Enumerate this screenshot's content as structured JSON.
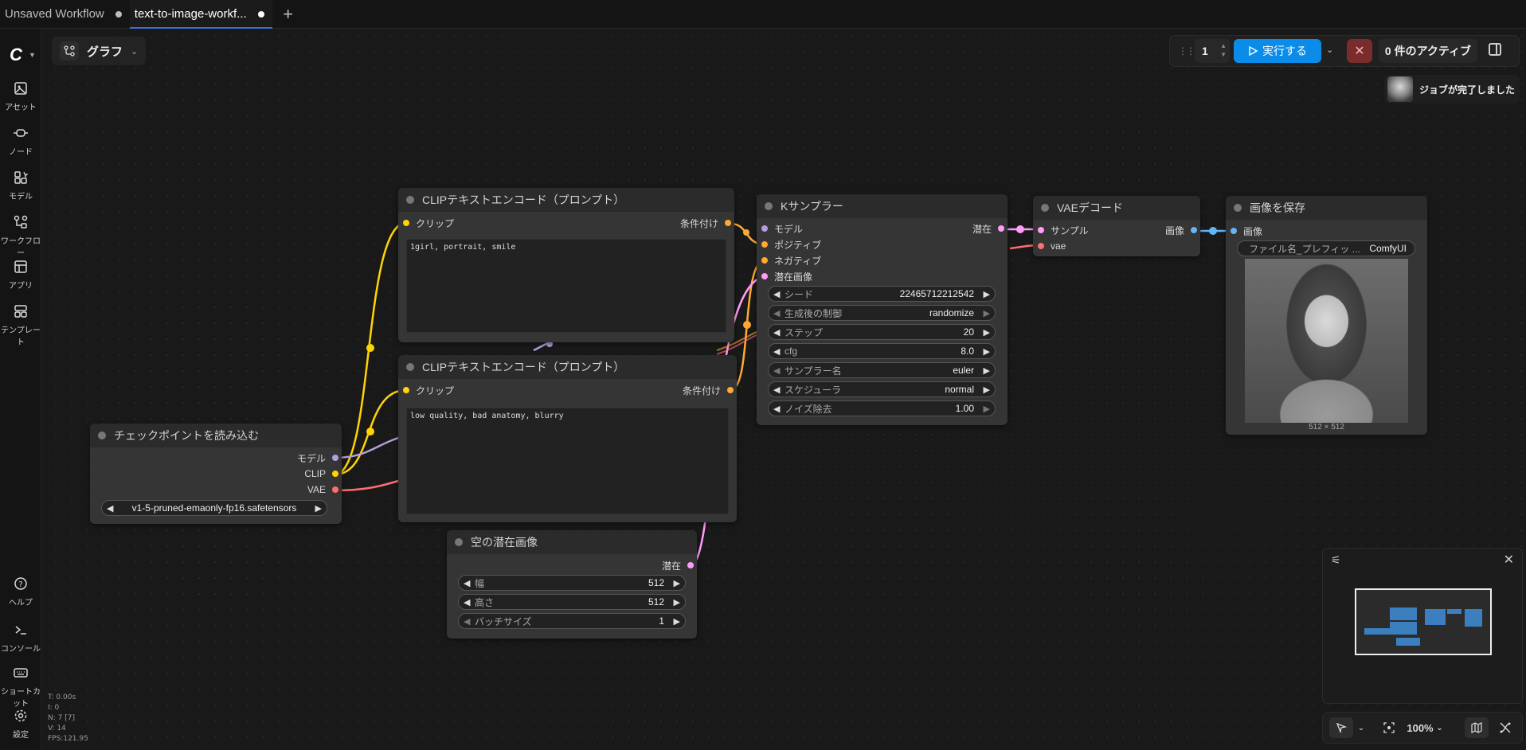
{
  "tabs": [
    {
      "label": "Unsaved Workflow"
    },
    {
      "label": "text-to-image-workf..."
    }
  ],
  "sidebar": {
    "top_items": [
      {
        "label": "アセット",
        "icon": "image-icon"
      },
      {
        "label": "ノード",
        "icon": "node-icon"
      },
      {
        "label": "モデル",
        "icon": "model-icon"
      },
      {
        "label": "ワークフロー",
        "icon": "workflow-icon"
      },
      {
        "label": "アプリ",
        "icon": "app-icon"
      },
      {
        "label": "テンプレート",
        "icon": "template-icon"
      }
    ],
    "bottom_items": [
      {
        "label": "ヘルプ",
        "icon": "help-icon"
      },
      {
        "label": "コンソール",
        "icon": "console-icon"
      },
      {
        "label": "ショートカット",
        "icon": "keyboard-icon"
      },
      {
        "label": "設定",
        "icon": "gear-icon"
      }
    ]
  },
  "graph_menu": {
    "label": "グラフ"
  },
  "run_toolbar": {
    "queue_count": "1",
    "run_label": "実行する",
    "active_jobs": "0 件のアクティブ"
  },
  "job_toast": {
    "label": "ジョブが完了しました"
  },
  "nodes": {
    "clip_pos": {
      "title": "CLIPテキストエンコード（プロンプト）",
      "input": "クリップ",
      "output": "条件付け",
      "text": "1girl, portrait, smile"
    },
    "clip_neg": {
      "title": "CLIPテキストエンコード（プロンプト）",
      "input": "クリップ",
      "output": "条件付け",
      "text": "low quality, bad anatomy, blurry"
    },
    "checkpoint": {
      "title": "チェックポイントを読み込む",
      "outputs": [
        "モデル",
        "CLIP",
        "VAE"
      ],
      "ckpt_name": "v1-5-pruned-emaonly-fp16.safetensors"
    },
    "ksampler": {
      "title": "Kサンプラー",
      "inputs": [
        "モデル",
        "ポジティブ",
        "ネガティブ",
        "潜在画像"
      ],
      "output": "潜在",
      "widgets": [
        {
          "name": "シード",
          "value": "22465712212542"
        },
        {
          "name": "生成後の制御",
          "value": "randomize"
        },
        {
          "name": "ステップ",
          "value": "20"
        },
        {
          "name": "cfg",
          "value": "8.0"
        },
        {
          "name": "サンプラー名",
          "value": "euler"
        },
        {
          "name": "スケジューラ",
          "value": "normal"
        },
        {
          "name": "ノイズ除去",
          "value": "1.00"
        }
      ]
    },
    "latent": {
      "title": "空の潜在画像",
      "output": "潜在",
      "widgets": [
        {
          "name": "幅",
          "value": "512"
        },
        {
          "name": "高さ",
          "value": "512"
        },
        {
          "name": "バッチサイズ",
          "value": "1"
        }
      ]
    },
    "vae_decode": {
      "title": "VAEデコード",
      "inputs": [
        "サンプル",
        "vae"
      ],
      "output": "画像"
    },
    "save_image": {
      "title": "画像を保存",
      "input": "画像",
      "prefix_label": "ファイル名_プレフィッ ...",
      "prefix_value": "ComfyUI",
      "image_size": "512 × 512"
    }
  },
  "bottom_toolbar": {
    "zoom": "100%"
  },
  "stats": [
    "T: 0.00s",
    "I: 0",
    "N: 7 [7]",
    "V: 14",
    "FPS:121.95"
  ],
  "colors": {
    "accent": "#0b8ce9",
    "clip": "#ffd500",
    "model": "#b39ddb",
    "vae": "#ff6e6e",
    "conditioning": "#ffa931",
    "latent": "#ff9cf9",
    "image": "#64b5f6"
  }
}
